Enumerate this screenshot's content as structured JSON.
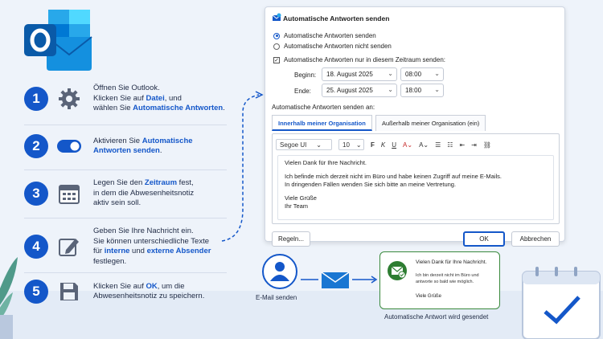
{
  "steps": [
    {
      "number": "1",
      "icon": "gear-icon",
      "line1": "Öffnen Sie Outlook.",
      "line2a": "Klicken Sie auf ",
      "line2b": "Datei",
      "line2c": ", und",
      "line3a": "wählen Sie ",
      "line3b": "Automatische Antworten",
      "line3c": "."
    },
    {
      "number": "2",
      "icon": "toggle-icon",
      "line1a": "Aktivieren Sie ",
      "line1b": "Automatische",
      "line2": "Antworten senden",
      "line2c": "."
    },
    {
      "number": "3",
      "icon": "calendar-icon",
      "line1a": "Legen Sie den ",
      "line1b": "Zeitraum",
      "line1c": " fest,",
      "line2": "in dem die Abwesenheitsnotiz",
      "line3": "aktiv sein soll."
    },
    {
      "number": "4",
      "icon": "edit-icon",
      "line1": "Geben Sie Ihre Nachricht ein.",
      "line2": "Sie können unterschiedliche Texte",
      "line3a": "für ",
      "line3b": "interne",
      "line3c": " und ",
      "line3d": "externe Absender",
      "line4": "festlegen."
    },
    {
      "number": "5",
      "icon": "save-icon",
      "line1a": "Klicken Sie auf ",
      "line1b": "OK",
      "line1c": ", um die",
      "line2": "Abwesenheitsnotiz zu speichern."
    }
  ],
  "dialog": {
    "title": "Automatische Antworten senden",
    "radio_send": "Automatische Antworten senden",
    "radio_nosend": "Automatische Antworten nicht senden",
    "checkbox_period": "Automatische Antworten nur in diesem Zeitraum senden:",
    "start_label": "Beginn:",
    "start_date": "18. August 2025",
    "start_time": "08:00",
    "end_label": "Ende:",
    "end_date": "25. August 2025",
    "end_time": "18:00",
    "send_to_label": "Automatische Antworten senden an:",
    "tab_internal": "Innerhalb meiner Organisation",
    "tab_external": "Außerhalb meiner Organisation (ein)",
    "font": "Segoe UI",
    "font_size": "10",
    "bold": "F",
    "italic": "K",
    "underline": "U",
    "message": {
      "line1": "Vielen Dank für Ihre Nachricht.",
      "line2": "Ich befinde mich derzeit nicht im Büro und habe keinen Zugriff auf meine E-Mails.",
      "line3": "In dringenden Fällen wenden Sie sich bitte an meine Vertretung.",
      "line4": "Viele Grüße",
      "line5": "Ihr Team"
    },
    "rules_button": "Regeln...",
    "ok_button": "OK",
    "cancel_button": "Abbrechen"
  },
  "flow": {
    "email_sent": "E-Mail senden",
    "auto_reply_sent": "Automatische Antwort wird gesendet",
    "reply_title": "Vielen Dank für Ihre Nachricht.",
    "reply_body1": "Ich bin derzeit nicht im Büro und",
    "reply_body2": "antworte so bald wie möglich.",
    "reply_sign": "Viele Grüße"
  },
  "colors": {
    "accent": "#1457c9",
    "success": "#2e7d32",
    "background": "#eef3fa"
  }
}
